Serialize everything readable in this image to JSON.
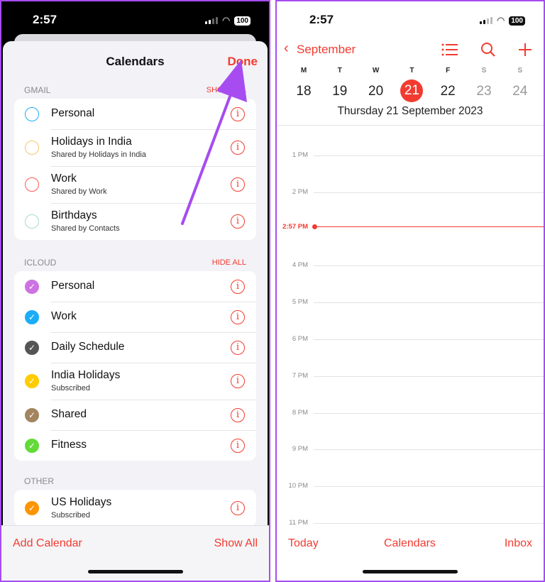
{
  "left": {
    "status": {
      "time": "2:57",
      "battery": "100"
    },
    "title": "Calendars",
    "done": "Done",
    "sections": [
      {
        "header": "GMAIL",
        "action": "SHOW ALL",
        "items": [
          {
            "name": "Personal",
            "sub": "",
            "color": "#1badf8",
            "checked": false
          },
          {
            "name": "Holidays in India",
            "sub": "Shared by Holidays in India",
            "color": "#f7c76a",
            "checked": false
          },
          {
            "name": "Work",
            "sub": "Shared by Work",
            "color": "#ff5a50",
            "checked": false
          },
          {
            "name": "Birthdays",
            "sub": "Shared by Contacts",
            "color": "#a8dcc4",
            "checked": false
          }
        ]
      },
      {
        "header": "ICLOUD",
        "action": "HIDE ALL",
        "items": [
          {
            "name": "Personal",
            "sub": "",
            "color": "#cc73e1",
            "checked": true
          },
          {
            "name": "Work",
            "sub": "",
            "color": "#1badf8",
            "checked": true
          },
          {
            "name": "Daily Schedule",
            "sub": "",
            "color": "#555555",
            "checked": true
          },
          {
            "name": "India Holidays",
            "sub": "Subscribed",
            "color": "#ffcc00",
            "checked": true
          },
          {
            "name": "Shared",
            "sub": "",
            "color": "#a2845e",
            "checked": true
          },
          {
            "name": "Fitness",
            "sub": "",
            "color": "#63da38",
            "checked": true
          }
        ]
      },
      {
        "header": "OTHER",
        "action": "",
        "items": [
          {
            "name": "US Holidays",
            "sub": "Subscribed",
            "color": "#ff9500",
            "checked": true
          }
        ]
      }
    ],
    "add_calendar": "Add Calendar",
    "show_all": "Show All"
  },
  "right": {
    "status": {
      "time": "2:57",
      "battery": "100"
    },
    "month": "September",
    "weekdays": [
      "M",
      "T",
      "W",
      "T",
      "F",
      "S",
      "S"
    ],
    "days": [
      "18",
      "19",
      "20",
      "21",
      "22",
      "23",
      "24"
    ],
    "selected_day": "21",
    "full_date": "Thursday  21 September 2023",
    "hours": [
      "1 PM",
      "2 PM",
      "",
      "4 PM",
      "5 PM",
      "6 PM",
      "7 PM",
      "8 PM",
      "9 PM",
      "10 PM",
      "11 PM"
    ],
    "now": "2:57 PM",
    "toolbar": {
      "today": "Today",
      "calendars": "Calendars",
      "inbox": "Inbox"
    }
  },
  "accent": "#f23b30",
  "annotation_color": "#a64cf0"
}
